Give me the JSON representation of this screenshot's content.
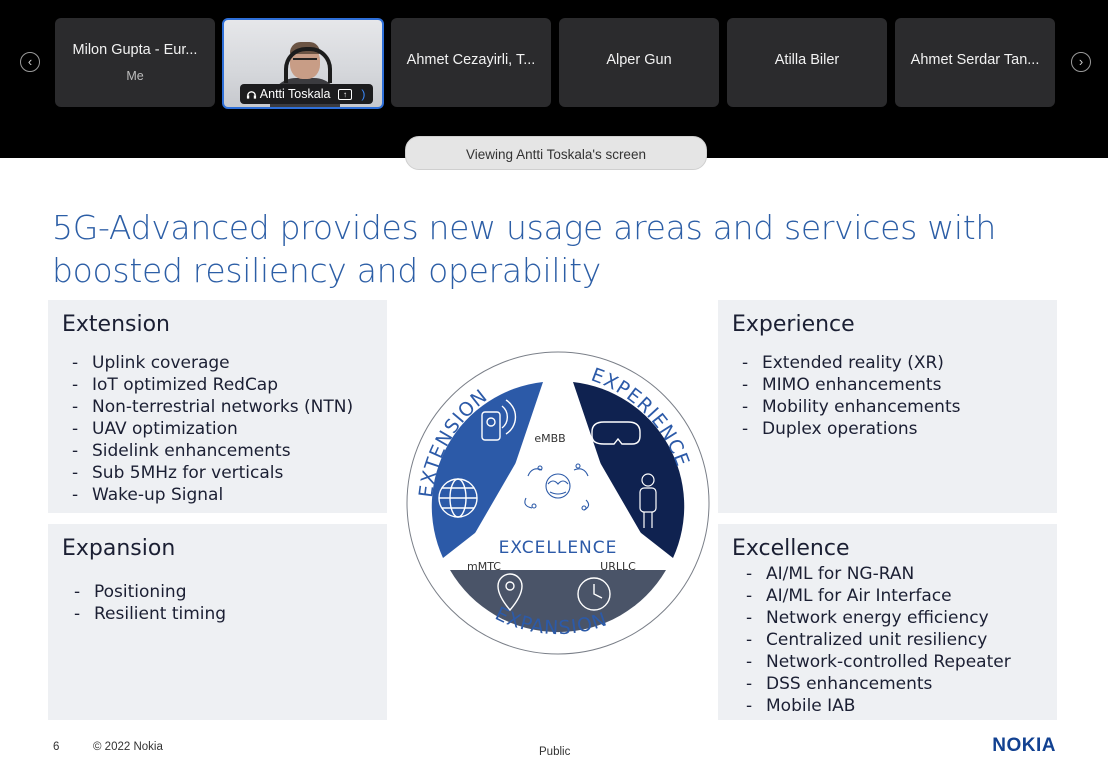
{
  "participants": [
    {
      "name": "Milon Gupta - Eur...",
      "sub": "Me"
    },
    {
      "name": "Antti Toskala"
    },
    {
      "name": "Ahmet Cezayirli, T..."
    },
    {
      "name": "Alper Gun"
    },
    {
      "name": "Atilla Biler"
    },
    {
      "name": "Ahmet Serdar Tan..."
    }
  ],
  "nav": {
    "prev": "‹",
    "next": "›"
  },
  "viewing_banner": "Viewing Antti Toskala's screen",
  "slide": {
    "title": "5G-Advanced provides new usage areas and services with boosted resiliency and operability",
    "extension": {
      "heading": "Extension",
      "items": [
        "Uplink coverage",
        "IoT optimized RedCap",
        "Non-terrestrial networks (NTN)",
        "UAV optimization",
        "Sidelink enhancements",
        "Sub 5MHz for verticals",
        "Wake-up Signal"
      ]
    },
    "expansion": {
      "heading": "Expansion",
      "items": [
        "Positioning",
        "Resilient timing"
      ]
    },
    "experience": {
      "heading": "Experience",
      "items": [
        "Extended reality (XR)",
        "MIMO enhancements",
        "Mobility enhancements",
        "Duplex operations"
      ]
    },
    "excellence": {
      "heading": "Excellence",
      "items": [
        "AI/ML for NG-RAN",
        "AI/ML for Air Interface",
        "Network energy efficiency",
        "Centralized unit resiliency",
        "Network-controlled Repeater",
        "DSS enhancements",
        "Mobile IAB"
      ]
    },
    "diagram": {
      "ring_extension": "EXTENSION",
      "ring_experience": "EXPERIENCE",
      "ring_expansion": "EXPANSION",
      "center": "EXCELLENCE",
      "embb": "eMBB",
      "mmtc": "mMTC",
      "urllc": "URLLC",
      "colors": {
        "extension": "#2c5aa8",
        "experience": "#0f2250",
        "expansion": "#4a5468"
      }
    },
    "footer": {
      "page": "6",
      "copyright": "© 2022 Nokia",
      "classification": "Public",
      "logo": "NOKIA"
    }
  }
}
